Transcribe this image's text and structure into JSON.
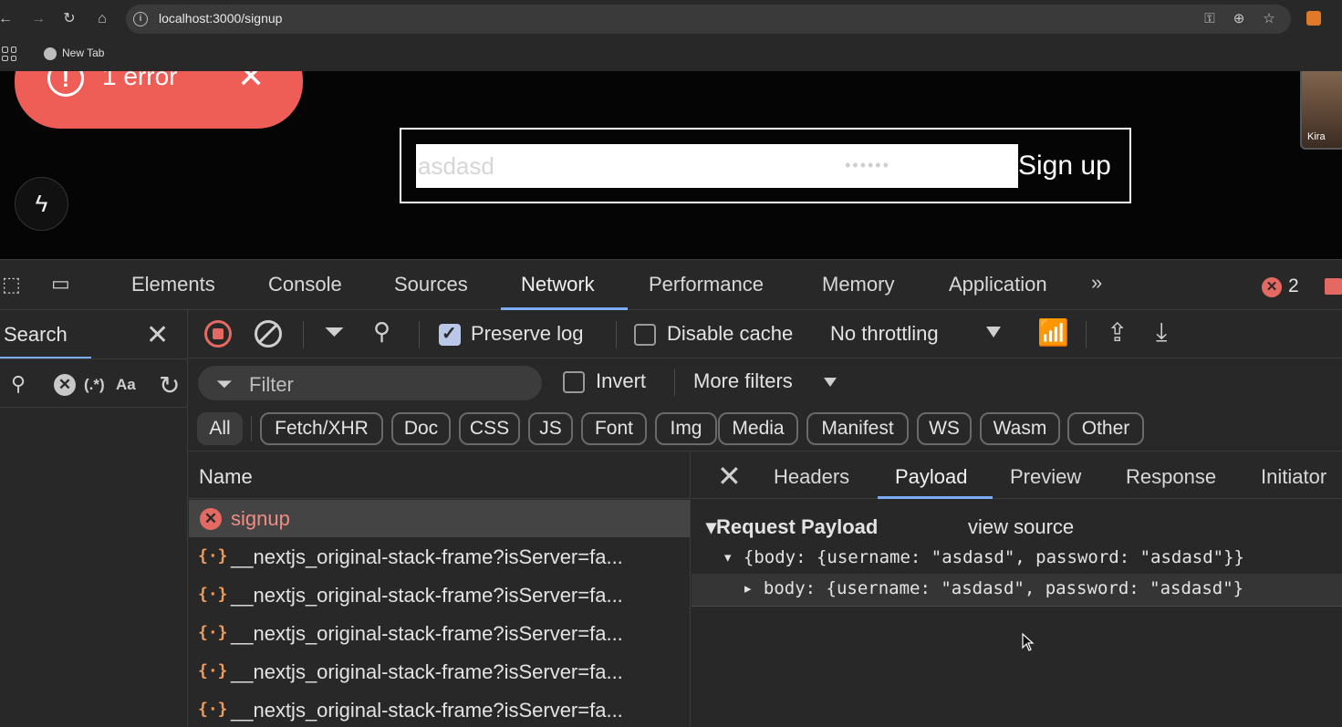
{
  "browser": {
    "url": "localhost:3000/signup",
    "bookmark_new_tab": "New Tab",
    "video_label": "Kira"
  },
  "page": {
    "error_toast": "1 error",
    "username_value": "asdasd",
    "password_mask": "••••••",
    "signup_button": "Sign up"
  },
  "devtools": {
    "tabs": [
      "Elements",
      "Console",
      "Sources",
      "Network",
      "Performance",
      "Memory",
      "Application"
    ],
    "active_tab": "Network",
    "error_count": "2",
    "search_pane_title": "Search",
    "search_regex": "(.*)",
    "search_case": "Aa",
    "preserve_log_label": "Preserve log",
    "preserve_log_checked": true,
    "disable_cache_label": "Disable cache",
    "disable_cache_checked": false,
    "throttling": "No throttling",
    "filter_placeholder": "Filter",
    "invert_label": "Invert",
    "more_filters_label": "More filters",
    "type_filters": [
      "All",
      "Fetch/XHR",
      "Doc",
      "CSS",
      "JS",
      "Font",
      "Img",
      "Media",
      "Manifest",
      "WS",
      "Wasm",
      "Other"
    ],
    "active_type_filter": "All",
    "list_header": "Name",
    "requests": [
      {
        "name": "signup",
        "status": "error"
      },
      {
        "name": "__nextjs_original-stack-frame?isServer=fa...",
        "status": "fetch"
      },
      {
        "name": "__nextjs_original-stack-frame?isServer=fa...",
        "status": "fetch"
      },
      {
        "name": "__nextjs_original-stack-frame?isServer=fa...",
        "status": "fetch"
      },
      {
        "name": "__nextjs_original-stack-frame?isServer=fa...",
        "status": "fetch"
      },
      {
        "name": "__nextjs_original-stack-frame?isServer=fa...",
        "status": "fetch"
      }
    ],
    "detail_tabs": [
      "Headers",
      "Payload",
      "Preview",
      "Response",
      "Initiator"
    ],
    "active_detail_tab": "Payload",
    "payload_heading": "Request Payload",
    "view_source_label": "view source",
    "payload_line1": "{body: {username: \"asdasd\", password: \"asdasd\"}}",
    "payload_line2": "body: {username: \"asdasd\", password: \"asdasd\"}"
  },
  "colors": {
    "accent": "#7cacf8",
    "error": "#e46962",
    "toast": "#ef5d57",
    "panel_bg": "#282828"
  }
}
